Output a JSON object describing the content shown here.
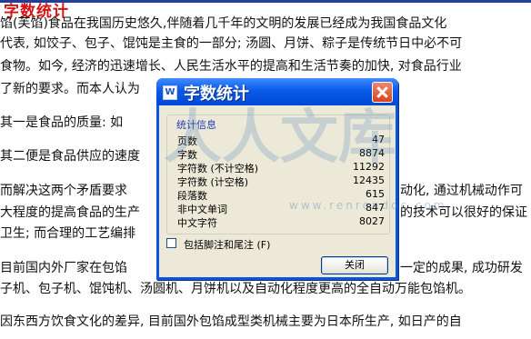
{
  "document": {
    "heading": "字数统计",
    "lines": [
      "馅(芙馅)食品在我国历史悠久,伴随着几千年的文明的发展已经成为我国食品文化",
      "代表, 如饺子、包子、馄饨是主食的一部分; 汤圆、月饼、粽子是传统节日中必不可",
      "食物。如今, 经济的迅速增长、人民生活水平的提高和生活节奏的加快, 对食品行业",
      "了新的要求。而本人认为",
      "其一是食品的质量: 如",
      "其二便是食品供应的速度",
      "而解决这两个矛盾要求",
      "大程度的提高食品的生产",
      "卫生; 而合理的工艺编排",
      "目前国内外厂家在包馅",
      "子机、包子机、馄饨机、汤圆机、月饼机以及自动化程度更高的全自动万能包馅机。",
      "因东西方饮食文化的差异, 目前国外包馅成型类机械主要为日本所生产, 如日产的自"
    ],
    "right_fragments": [
      "动化, 通过机械动作可",
      "的技术可以很好的保证",
      "一定的成果, 成功研发"
    ],
    "watermark_text": "人人文库",
    "watermark_url": "www.renrendoc.com"
  },
  "dialog": {
    "app_icon_letter": "W",
    "title": "字数统计",
    "group_title": "统计信息",
    "stats": [
      {
        "label": "页数",
        "value": "47"
      },
      {
        "label": "字数",
        "value": "8874"
      },
      {
        "label": "字符数 (不计空格)",
        "value": "11292"
      },
      {
        "label": "字符数 (计空格)",
        "value": "12435"
      },
      {
        "label": "段落数",
        "value": "615"
      },
      {
        "label": "非中文单词",
        "value": "847"
      },
      {
        "label": "中文字符",
        "value": "8027"
      }
    ],
    "checkbox_label": "包括脚注和尾注 (F)",
    "checkbox_checked": false,
    "close_label": "关闭"
  }
}
